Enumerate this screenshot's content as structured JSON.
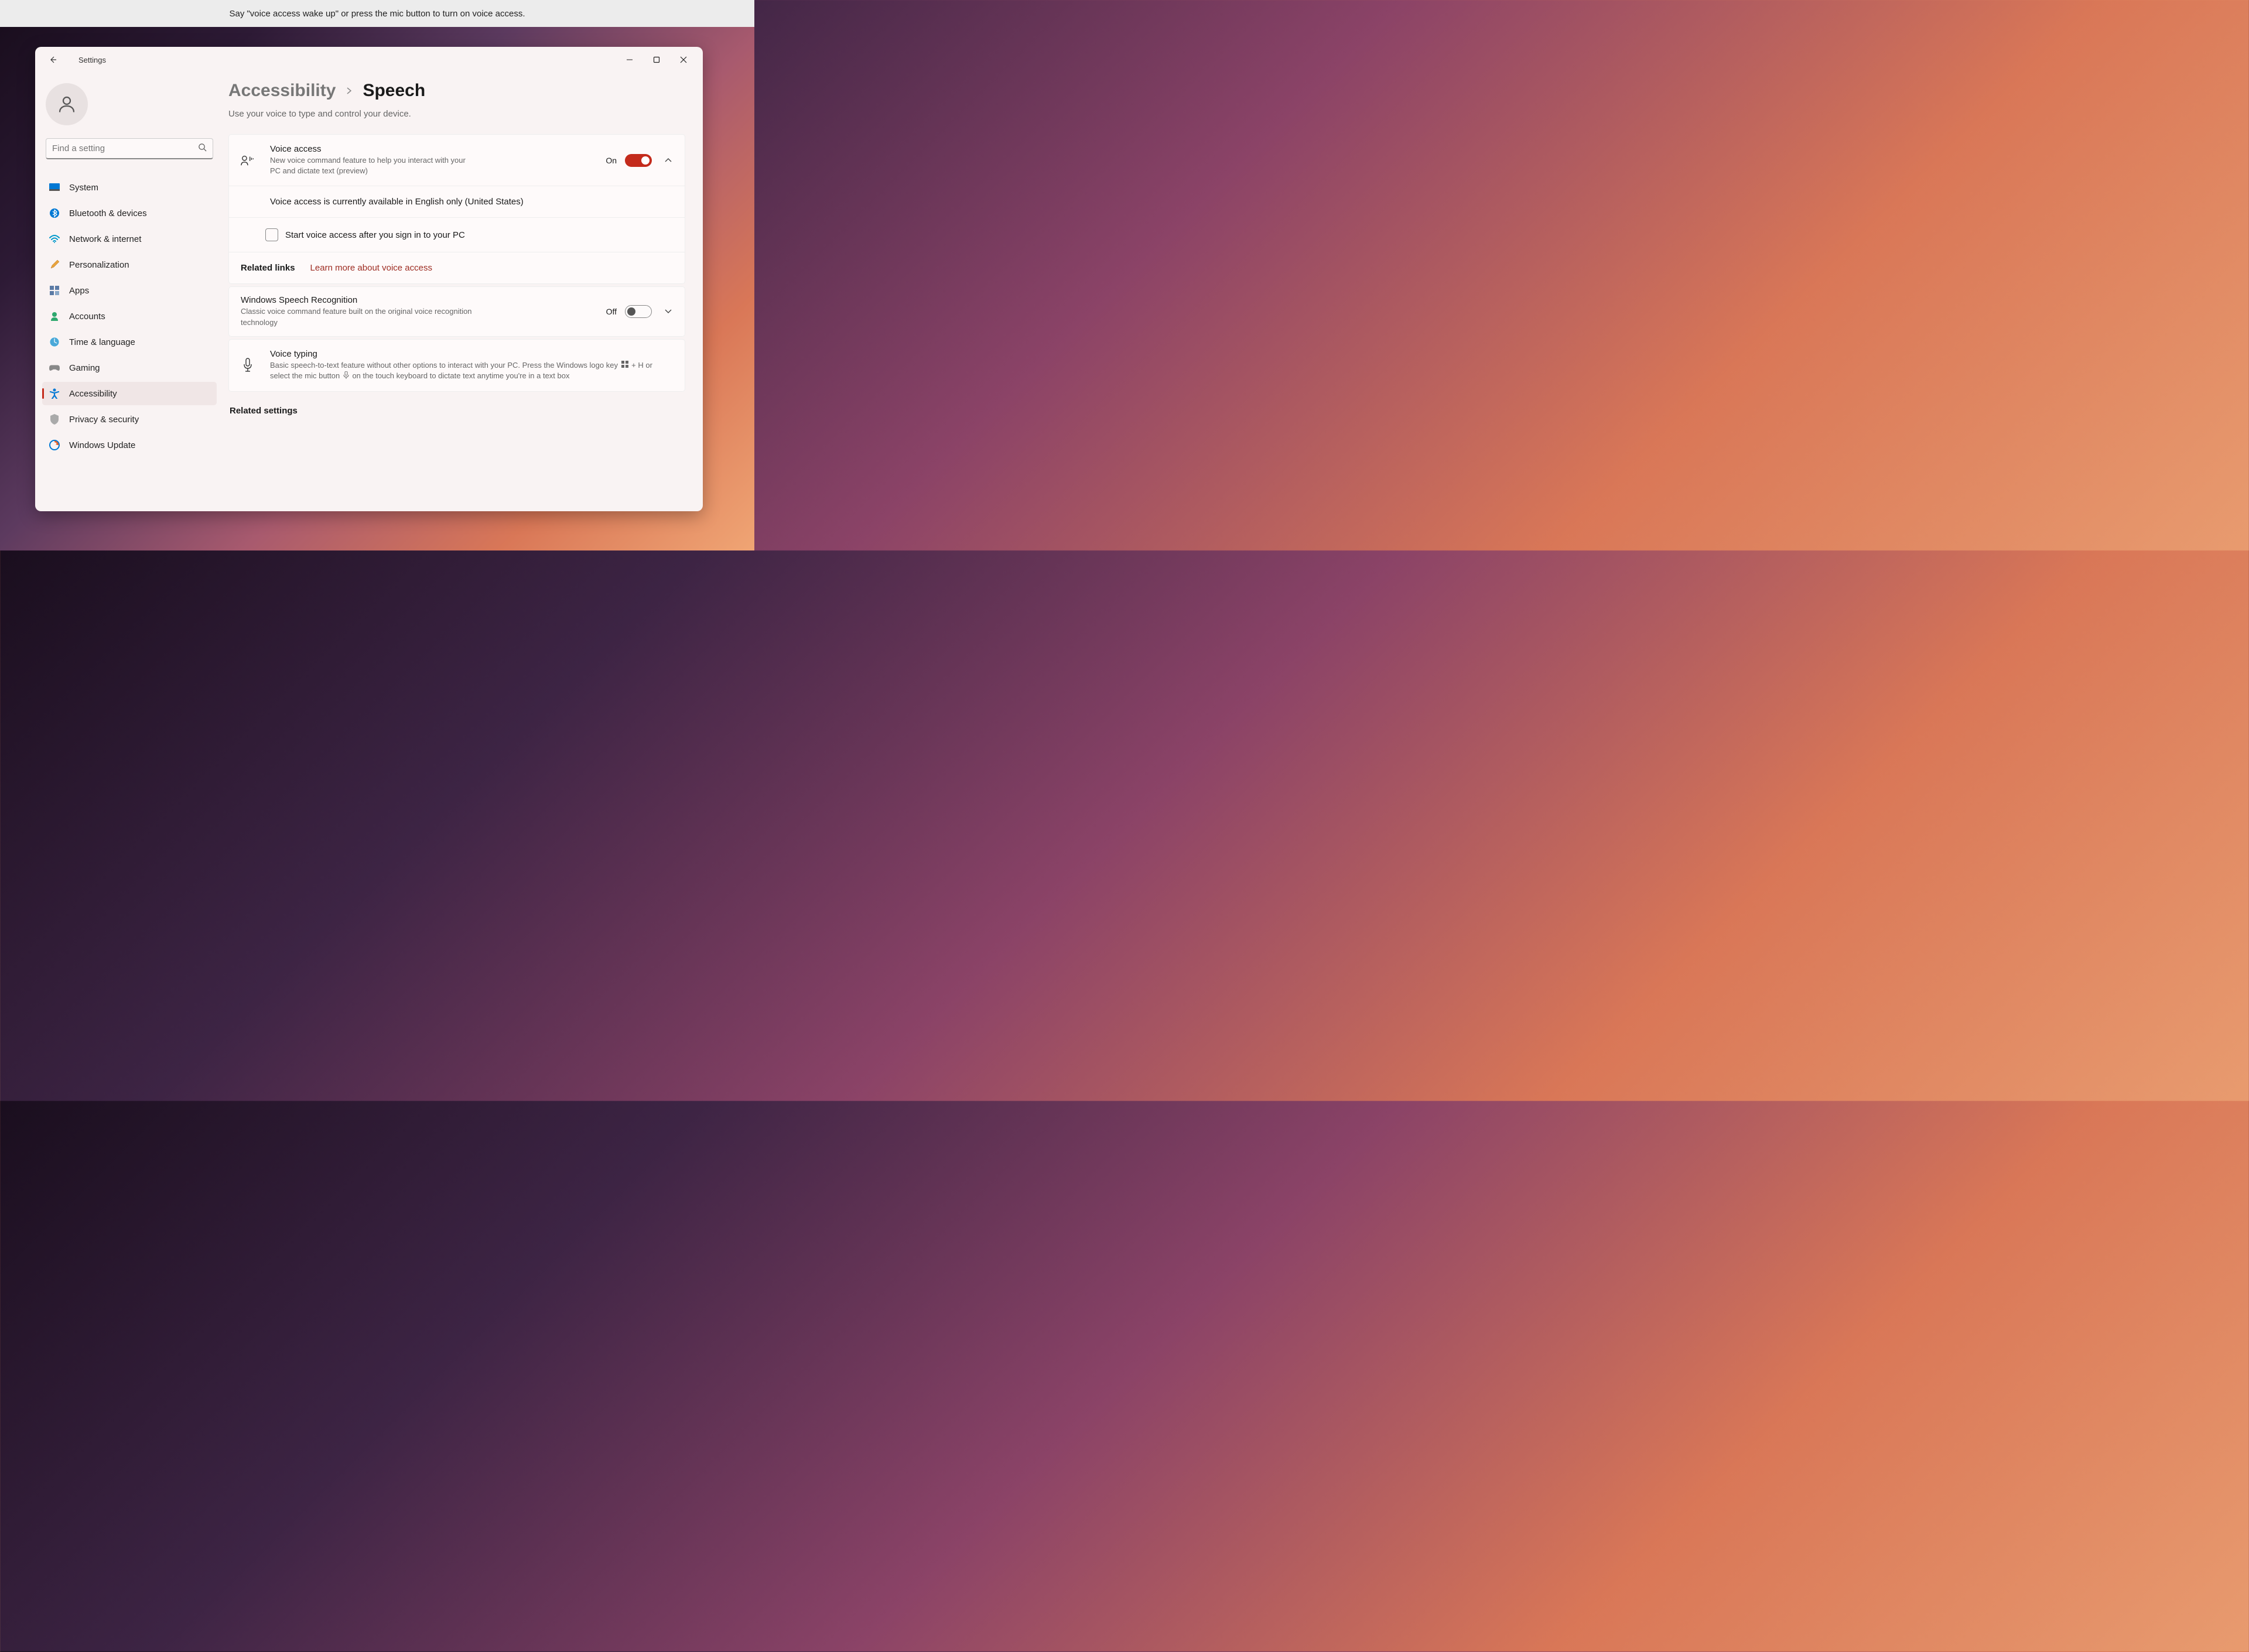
{
  "banner": {
    "text": "Say \"voice access wake up\" or press the mic button to turn on voice access."
  },
  "window": {
    "title": "Settings"
  },
  "search": {
    "placeholder": "Find a setting"
  },
  "sidebar": {
    "items": [
      {
        "label": "System"
      },
      {
        "label": "Bluetooth & devices"
      },
      {
        "label": "Network & internet"
      },
      {
        "label": "Personalization"
      },
      {
        "label": "Apps"
      },
      {
        "label": "Accounts"
      },
      {
        "label": "Time & language"
      },
      {
        "label": "Gaming"
      },
      {
        "label": "Accessibility"
      },
      {
        "label": "Privacy & security"
      },
      {
        "label": "Windows Update"
      }
    ]
  },
  "breadcrumb": {
    "parent": "Accessibility",
    "current": "Speech"
  },
  "page": {
    "description": "Use your voice to type and control your device."
  },
  "voice_access": {
    "title": "Voice access",
    "description": "New voice command feature to help you interact with your PC and dictate text (preview)",
    "state_label": "On",
    "availability_note": "Voice access is currently available in English only (United States)",
    "autostart_label": "Start voice access after you sign in to your PC",
    "related_label": "Related links",
    "learn_more": "Learn more about voice access"
  },
  "wsr": {
    "title": "Windows Speech Recognition",
    "description": "Classic voice command feature built on the original voice recognition technology",
    "state_label": "Off"
  },
  "voice_typing": {
    "title": "Voice typing",
    "desc_part1": "Basic speech-to-text feature without other options to interact with your PC. Press the Windows logo key ",
    "desc_part2": " + H or select the mic button ",
    "desc_part3": " on the touch keyboard to dictate text anytime you're in a text box"
  },
  "related_settings_heading": "Related settings",
  "colors": {
    "accent": "#c42b1c"
  }
}
